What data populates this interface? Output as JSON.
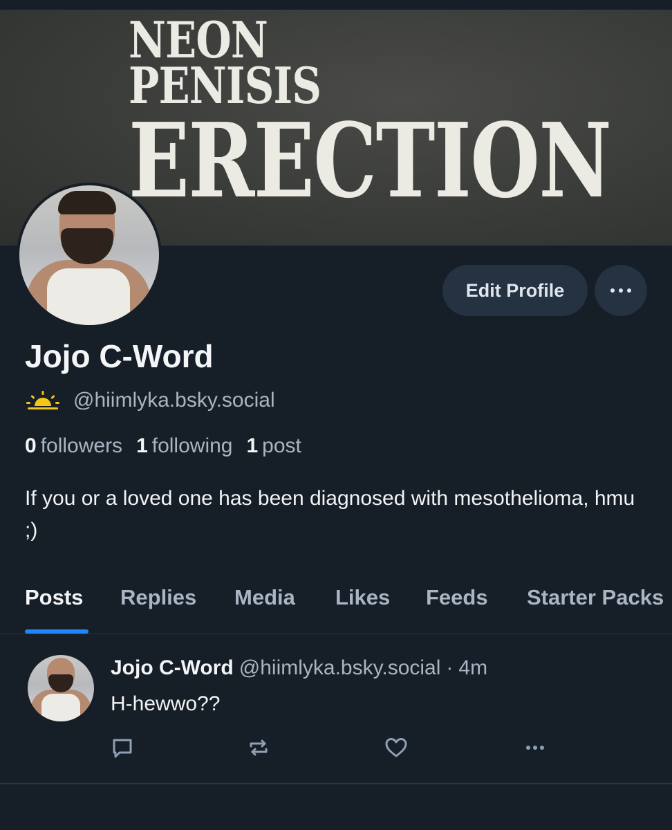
{
  "banner": {
    "line1": "NEON",
    "line2": "PENISIS",
    "line3": "ERECTION"
  },
  "profile": {
    "display_name": "Jojo C-Word",
    "handle": "@hiimlyka.bsky.social",
    "status_icon": "sunrise-icon",
    "bio": "If you or a loved one has been diagnosed with mesothelioma, hmu ;)",
    "edit_profile_label": "Edit Profile",
    "more_icon": "ellipsis-icon"
  },
  "stats": {
    "followers_count": "0",
    "followers_label": "followers",
    "following_count": "1",
    "following_label": "following",
    "posts_count": "1",
    "posts_label": "post"
  },
  "tabs": [
    {
      "label": "Posts",
      "active": true
    },
    {
      "label": "Replies",
      "active": false
    },
    {
      "label": "Media",
      "active": false
    },
    {
      "label": "Likes",
      "active": false
    },
    {
      "label": "Feeds",
      "active": false
    },
    {
      "label": "Starter Packs",
      "active": false
    }
  ],
  "post": {
    "author_name": "Jojo C-Word",
    "author_handle": "@hiimlyka.bsky.social",
    "separator": "·",
    "time": "4m",
    "text": "H-hewwo??",
    "actions": [
      "reply-icon",
      "repost-icon",
      "like-icon",
      "more-icon"
    ]
  },
  "colors": {
    "background": "#161e27",
    "accent": "#1f86ff",
    "muted_text": "#a9b5c3",
    "button_bg": "#243241",
    "sun_icon": "#f5c518"
  }
}
